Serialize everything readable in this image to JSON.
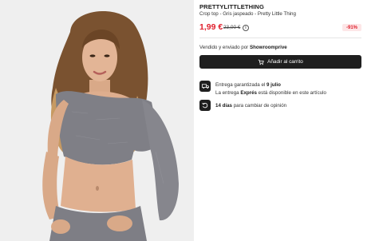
{
  "product": {
    "brand": "PRETTYLITTLETHING",
    "subtitle": "Crop top - Gris jaspeado - Pretty Little Thing",
    "price": "1,99 €",
    "old_price": "23,00 €",
    "discount": "-91%",
    "image_icon": "model-photo"
  },
  "seller": {
    "prefix": "Vendido y enviado por ",
    "name": "Showroomprive"
  },
  "cart_button": {
    "label": "Añadir al carrito",
    "icon": "cart-icon"
  },
  "delivery": {
    "icon": "truck-icon",
    "line1_prefix": "Entrega garantizada el ",
    "line1_date": "9 julio",
    "line2_prefix": "La entrega ",
    "line2_bold": "Exprés",
    "line2_suffix": " está disponible en este artículo"
  },
  "returns": {
    "icon": "return-arrow-icon",
    "bold": "14 días",
    "text": " para cambiar de opinión"
  },
  "colors": {
    "price": "#e0202d",
    "discount_bg": "#fde6e7",
    "button_bg": "#1f1f1f"
  }
}
